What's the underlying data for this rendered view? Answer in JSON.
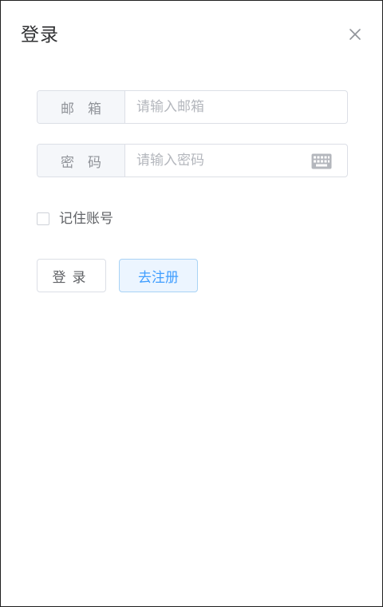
{
  "dialog": {
    "title": "登录",
    "close_icon": "close-icon"
  },
  "form": {
    "email": {
      "label": "邮箱",
      "placeholder": "请输入邮箱",
      "value": ""
    },
    "password": {
      "label": "密码",
      "placeholder": "请输入密码",
      "value": "",
      "suffix_icon": "keyboard-icon"
    },
    "remember": {
      "label": "记住账号",
      "checked": false
    }
  },
  "buttons": {
    "login_label": "登录",
    "register_label": "去注册"
  },
  "colors": {
    "primary": "#409eff",
    "primary_light_bg": "#ecf5ff",
    "border": "#dcdfe6",
    "prepend_bg": "#f5f7fa"
  }
}
